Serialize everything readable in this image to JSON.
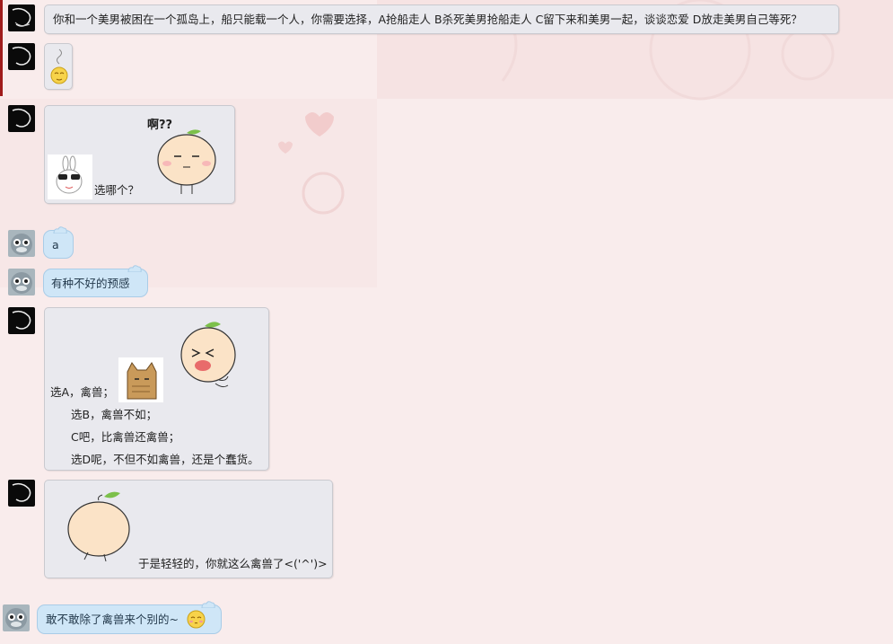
{
  "messages": [
    {
      "text": "你和一个美男被困在一个孤岛上，船只能载一个人，你需要选择，A抢船走人 B杀死美男抢船走人 C留下来和美男一起，谈谈恋爱 D放走美男自己等死？"
    },
    {
      "emoji": "dizzy-smiley"
    },
    {
      "text": "选哪个？",
      "sticker_text": "啊??"
    },
    {
      "text": "a"
    },
    {
      "text": "有种不好的预感"
    },
    {
      "lines": [
        "选A，禽兽；",
        "选B，禽兽不如；",
        "C吧，比禽兽还禽兽；",
        "选D呢，不但不如禽兽，还是个蠢货。"
      ]
    },
    {
      "text": "于是轻轻的，你就这么禽兽了<('^')>"
    },
    {
      "text": "敢不敢除了禽兽来个别的~"
    }
  ],
  "colors": {
    "incoming_bubble": "#e9e9ee",
    "outgoing_bubble": "#cfe6f7",
    "background": "#f9ecec",
    "accent_mark": "#a01c1c"
  }
}
